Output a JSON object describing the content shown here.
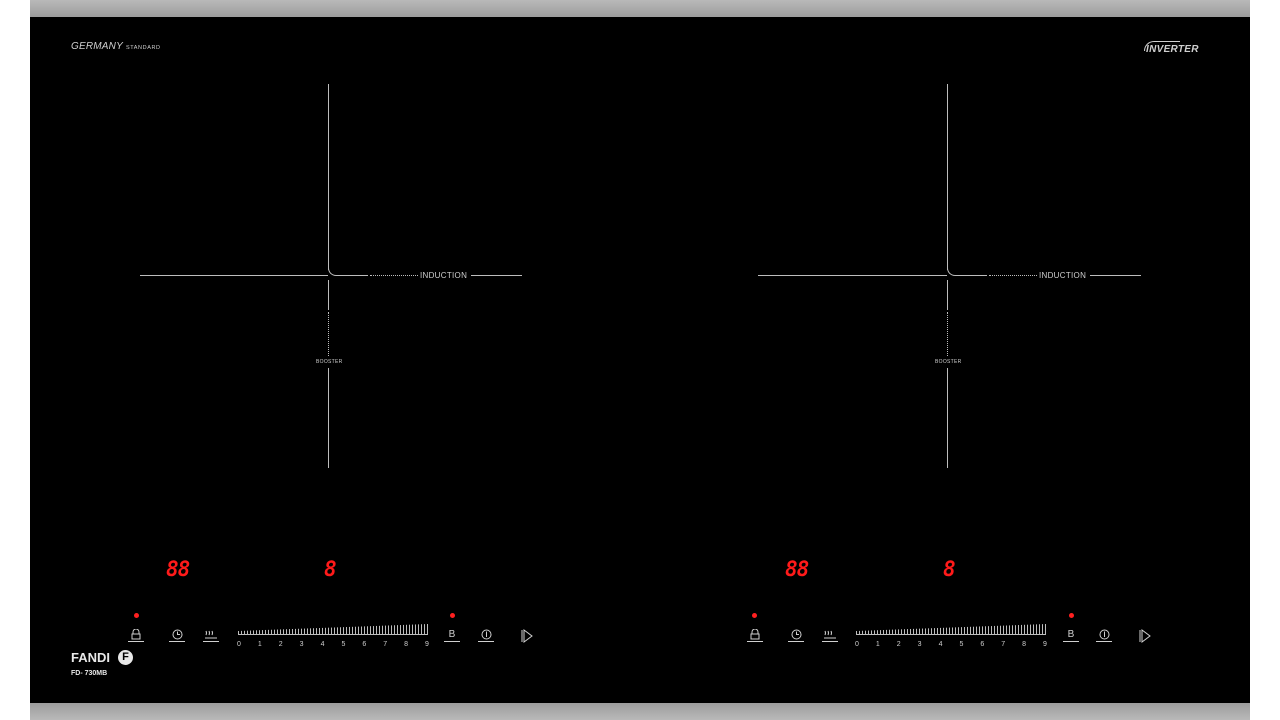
{
  "header": {
    "germany": "GERMANY",
    "standard": "STANDARD",
    "inverter": "INVERTER"
  },
  "brand": {
    "name": "FANDI",
    "logo_letter": "F",
    "model": "FD- 730MB"
  },
  "zones": [
    {
      "label_induction": "INDUCTION",
      "label_booster": "BOOSTER",
      "timer_display": "88",
      "power_display": "8"
    },
    {
      "label_induction": "INDUCTION",
      "label_booster": "BOOSTER",
      "timer_display": "88",
      "power_display": "8"
    }
  ],
  "controls": {
    "booster_label": "B",
    "slider_numbers": [
      "0",
      "1",
      "2",
      "3",
      "4",
      "5",
      "6",
      "7",
      "8",
      "9"
    ]
  },
  "colors": {
    "glass": "#000000",
    "rim": "#a6a6a6",
    "display": "#ff1a1a",
    "print": "#cfcfcf"
  },
  "icons": [
    "lock-icon",
    "timer-icon",
    "keep-warm-icon",
    "power-slider",
    "booster-icon",
    "power-icon",
    "pause-icon"
  ]
}
